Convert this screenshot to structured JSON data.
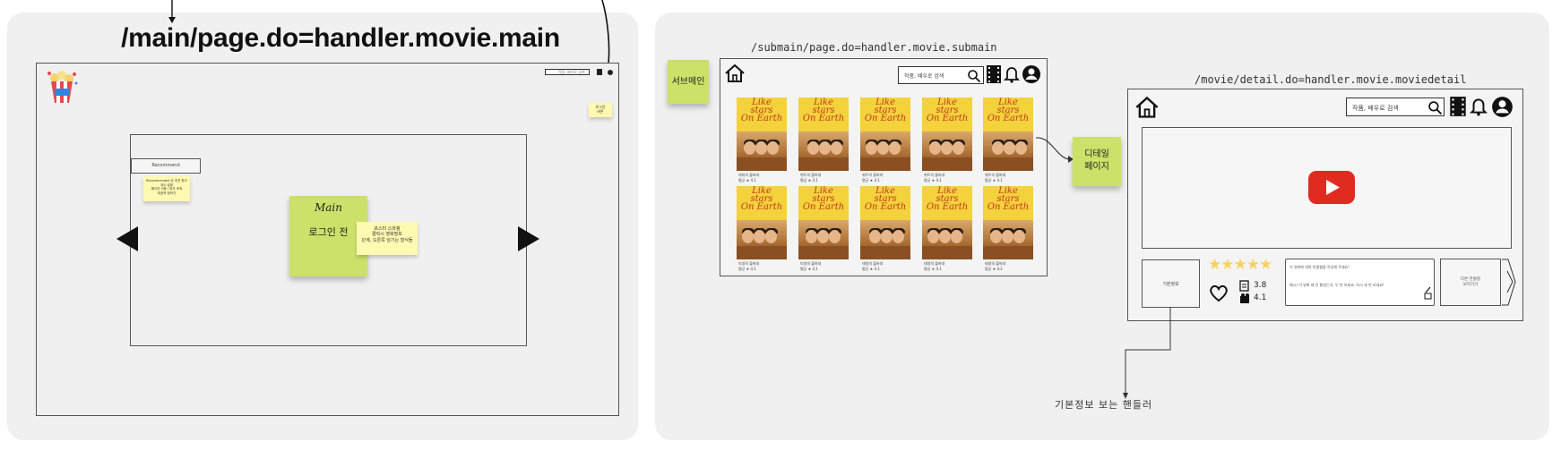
{
  "left_board": {
    "url_title": "/main/page.do=handler.movie.main",
    "search_placeholder": "작품, 배우로 검색",
    "top_right_note_lines": [
      "로그인",
      "버튼"
    ],
    "tab_label": "Recommend",
    "note_small_lines": [
      "Recommended 순 추천 한다",
      "개수 설정",
      "페이지 이동 / 좌우 조작",
      "대표작 정하기"
    ],
    "main_sticky_title": "Main",
    "main_sticky_body": "로그인 전",
    "poster_note_lines": [
      "포스터 스와핑",
      "클릭시 영화정보",
      "단계, 오른쪽 넘기는 형식들"
    ]
  },
  "right_board": {
    "submain_url": "/submain/page.do=handler.movie.submain",
    "submain_sticky": "서브메인",
    "detail_url": "/movie/detail.do=handler.movie.moviedetail",
    "detail_sticky_lines": [
      "디테일",
      "페이지"
    ],
    "search_placeholder": "작품, 배우로 검색",
    "detail_search_placeholder": "작품, 배우로 검색",
    "poster_title_lines": [
      "Like",
      "stars",
      "On Earth"
    ],
    "posters": [
      {
        "name": "레미의 불바대",
        "score": "평균 ★ 4.1"
      },
      {
        "name": "위트의 불바대",
        "score": "평균 ★ 4.1"
      },
      {
        "name": "위트의 불바대",
        "score": "평균 ★ 4.1"
      },
      {
        "name": "위트의 불바대",
        "score": "평균 ★ 4.1"
      },
      {
        "name": "위트의 불바대",
        "score": "평균 ★ 4.1"
      },
      {
        "name": "미영의 불바대",
        "score": "평균 ★ 4.1"
      },
      {
        "name": "미영의 불바대",
        "score": "평균 ★ 4.1"
      },
      {
        "name": "태영의 불바대",
        "score": "평균 ★ 4.1"
      },
      {
        "name": "태영의 불바대",
        "score": "평균 ★ 4.1"
      },
      {
        "name": "태영의 불바대",
        "score": "평균 ★ 4.2"
      }
    ],
    "basic_info_label": "기본정보",
    "rating_stars": 5,
    "rating_filled_stars": 5,
    "score_1": "3.8",
    "score_2": "4.1",
    "review_title": "이 영화에 대한 한줄평을 작성해 주세요!",
    "review_body": "예시) 이 영화 왜 안 봤었는지, 두 번 보세요. 하시 세 번 보세요!",
    "next_box_lines": [
      "다른 한줄평",
      "보러가기"
    ],
    "annotation": "기본정보 보는 핸들러"
  },
  "colors": {
    "board_bg": "#f0f0f0",
    "sticky_yellow": "#fff9b1",
    "sticky_green": "#cbe16a",
    "star_color": "#f4d35e",
    "play_red": "#e02b20"
  },
  "icons": [
    "popcorn-icon",
    "home-icon",
    "search-icon",
    "film-icon",
    "bell-icon",
    "user-icon",
    "play-icon",
    "heart-icon",
    "left-arrow-icon",
    "right-arrow-icon"
  ]
}
